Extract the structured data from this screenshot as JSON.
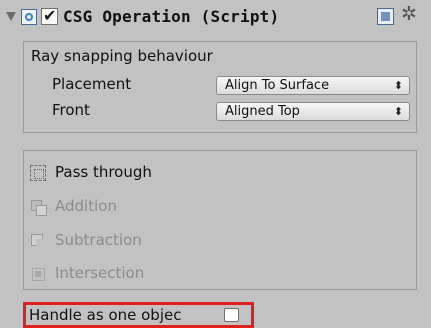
{
  "header": {
    "title": "CSG Operation (Script)",
    "enabled_check": "✔",
    "settings_glyph": "✲"
  },
  "snapping": {
    "heading": "Ray snapping behaviour",
    "placement_label": "Placement",
    "placement_value": "Align To Surface",
    "front_label": "Front",
    "front_value": "Aligned Top",
    "dropdown_arrow": "⬍"
  },
  "operations": {
    "items": [
      {
        "label": "Pass through",
        "icon": "pass-through-icon",
        "enabled": true
      },
      {
        "label": "Addition",
        "icon": "addition-icon",
        "enabled": false
      },
      {
        "label": "Subtraction",
        "icon": "subtraction-icon",
        "enabled": false
      },
      {
        "label": "Intersection",
        "icon": "intersection-icon",
        "enabled": false
      }
    ]
  },
  "handle": {
    "label": "Handle as one objec",
    "checked": false
  },
  "colors": {
    "background": "#c2c2c2",
    "highlight": "#e0201c"
  }
}
